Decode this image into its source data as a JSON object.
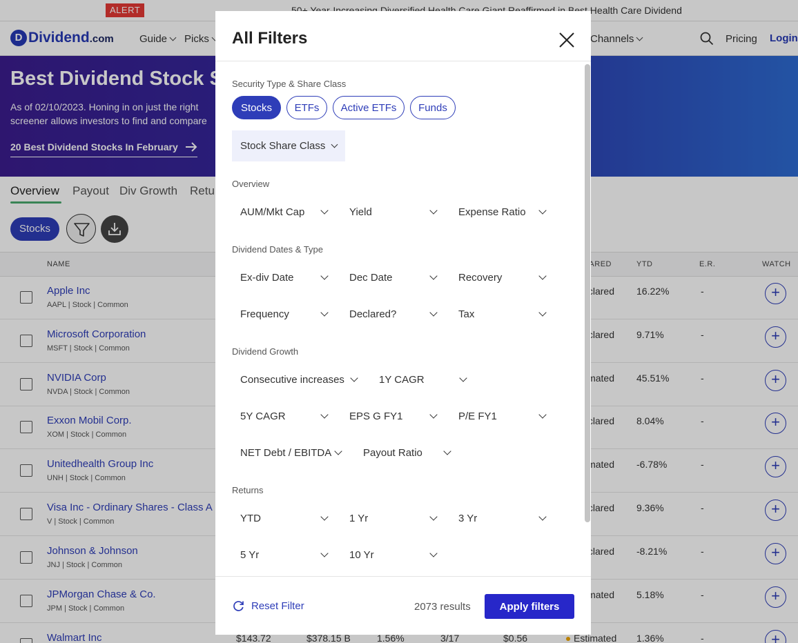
{
  "alert": {
    "badge": "ALERT",
    "text": "50+ Year-Increasing Diversified Health Care Giant Reaffirmed in Best Health Care Dividend"
  },
  "nav": {
    "logo_text": "Dividend",
    "logo_suffix": ".com",
    "logo_mark": "D",
    "items": [
      "Guide",
      "Picks",
      "Channels"
    ],
    "pricing": "Pricing",
    "login": "Login"
  },
  "hero": {
    "title": "Best Dividend Stock Screener",
    "desc_line1": "As of 02/10/2023. Honing in on just the right",
    "desc_line2": "screener allows investors to find and compare",
    "link": "20 Best Dividend Stocks In February"
  },
  "tabs": [
    "Overview",
    "Payout",
    "Div Growth",
    "Returns"
  ],
  "toolbar": {
    "stocks_pill": "Stocks"
  },
  "table": {
    "headers": {
      "name": "NAME",
      "declared": "DECLARED?",
      "ytd": "YTD",
      "er": "E.R.",
      "watch": "WATCH"
    },
    "rows": [
      {
        "name": "Apple Inc",
        "sub": "AAPL | Stock | Common",
        "declared": "Declared",
        "ytd": "16.22%",
        "er": "-"
      },
      {
        "name": "Microsoft Corporation",
        "sub": "MSFT | Stock | Common",
        "declared": "Declared",
        "ytd": "9.71%",
        "er": "-"
      },
      {
        "name": "NVIDIA Corp",
        "sub": "NVDA | Stock | Common",
        "declared": "Estimated",
        "ytd": "45.51%",
        "er": "-"
      },
      {
        "name": "Exxon Mobil Corp.",
        "sub": "XOM | Stock | Common",
        "declared": "Declared",
        "ytd": "8.04%",
        "er": "-"
      },
      {
        "name": "Unitedhealth Group Inc",
        "sub": "UNH | Stock | Common",
        "declared": "Estimated",
        "ytd": "-6.78%",
        "er": "-"
      },
      {
        "name": "Visa Inc - Ordinary Shares - Class A",
        "sub": "V | Stock | Common",
        "declared": "Declared",
        "ytd": "9.36%",
        "er": "-"
      },
      {
        "name": "Johnson & Johnson",
        "sub": "JNJ | Stock | Common",
        "declared": "Declared",
        "ytd": "-8.21%",
        "er": "-"
      },
      {
        "name": "JPMorgan Chase & Co.",
        "sub": "JPM | Stock | Common",
        "declared": "Estimated",
        "ytd": "5.18%",
        "er": "-"
      },
      {
        "name": "Walmart Inc",
        "sub": "",
        "price": "$143.72",
        "aum": "$378.15 B",
        "yield": "1.56%",
        "exdiv": "3/17",
        "amount": "$0.56",
        "declared": "Estimated",
        "ytd": "1.36%",
        "er": "-"
      }
    ]
  },
  "modal": {
    "title": "All Filters",
    "sections": {
      "security": "Security Type & Share Class",
      "overview": "Overview",
      "dates": "Dividend Dates & Type",
      "growth": "Dividend Growth",
      "returns": "Returns"
    },
    "security_types": [
      "Stocks",
      "ETFs",
      "Active ETFs",
      "Funds"
    ],
    "active_security_type": "Stocks",
    "share_class": "Stock Share Class",
    "overview_filters": [
      "AUM/Mkt Cap",
      "Yield",
      "Expense Ratio"
    ],
    "dates_filters": [
      "Ex-div Date",
      "Dec Date",
      "Recovery",
      "Frequency",
      "Declared?",
      "Tax"
    ],
    "growth_filters": [
      "Consecutive increases",
      "1Y CAGR",
      "5Y CAGR",
      "EPS G FY1",
      "P/E FY1",
      "NET Debt / EBITDA",
      "Payout Ratio"
    ],
    "returns_filters": [
      "YTD",
      "1 Yr",
      "3 Yr",
      "5 Yr",
      "10 Yr"
    ],
    "reset": "Reset Filter",
    "results": "2073 results",
    "apply": "Apply filters"
  },
  "colors": {
    "brand": "#2e3db8",
    "apply": "#2727c9",
    "alert": "#e53935",
    "tab_underline": "#4aaa6d"
  },
  "icons": [
    "search-icon",
    "close-icon",
    "filter-icon",
    "download-icon",
    "reset-icon",
    "plus-icon",
    "arrow-right-icon",
    "chevron-down-icon"
  ]
}
